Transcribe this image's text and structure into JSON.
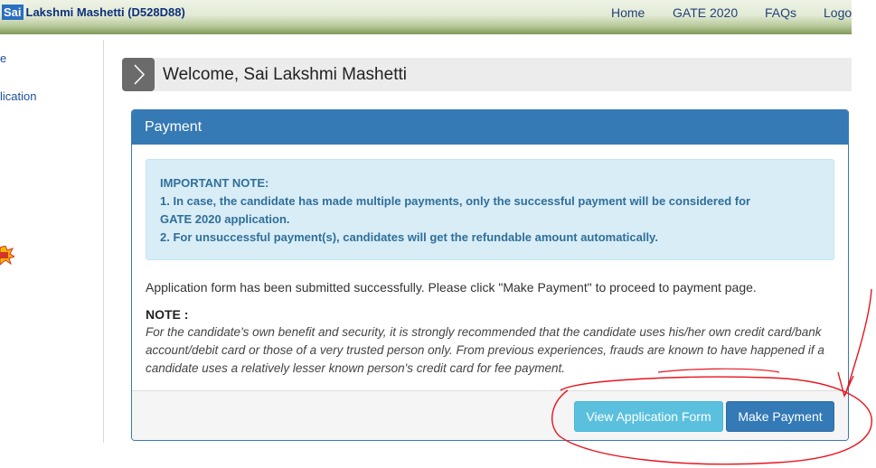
{
  "header": {
    "brand_badge": "Sai",
    "brand_name": "Lakshmi Mashetti (D528D88)",
    "nav": [
      "Home",
      "GATE 2020",
      "FAQs",
      "Logo"
    ]
  },
  "sidebar": {
    "items": [
      "e",
      "lication"
    ]
  },
  "welcome": {
    "title": "Welcome, Sai Lakshmi Mashetti"
  },
  "payment_panel": {
    "heading": "Payment",
    "alert": {
      "title": "IMPORTANT NOTE:",
      "line1": "1. In case, the candidate has made multiple payments, only the successful payment will be considered for",
      "line2": "GATE 2020 application.",
      "line3": "2. For unsuccessful payment(s), candidates will get the refundable amount automatically."
    },
    "success_message": "Application form has been submitted successfully. Please click \"Make Payment\" to proceed to payment page.",
    "note_label": "NOTE :",
    "note_body": "For the candidate's own benefit and security, it is strongly recommended that the candidate uses his/her own credit card/bank account/debit card or those of a very trusted person only. From previous experiences, frauds are known to have happened if a candidate uses a relatively lesser known person's credit card for fee payment.",
    "buttons": {
      "view": "View Application Form",
      "pay": "Make Payment"
    }
  },
  "colors": {
    "panel_header": "#3579b5",
    "alert_bg": "#d9edf6",
    "view_button": "#5bc0de",
    "pay_button": "#337ab7",
    "annotation": "#e8141e"
  }
}
